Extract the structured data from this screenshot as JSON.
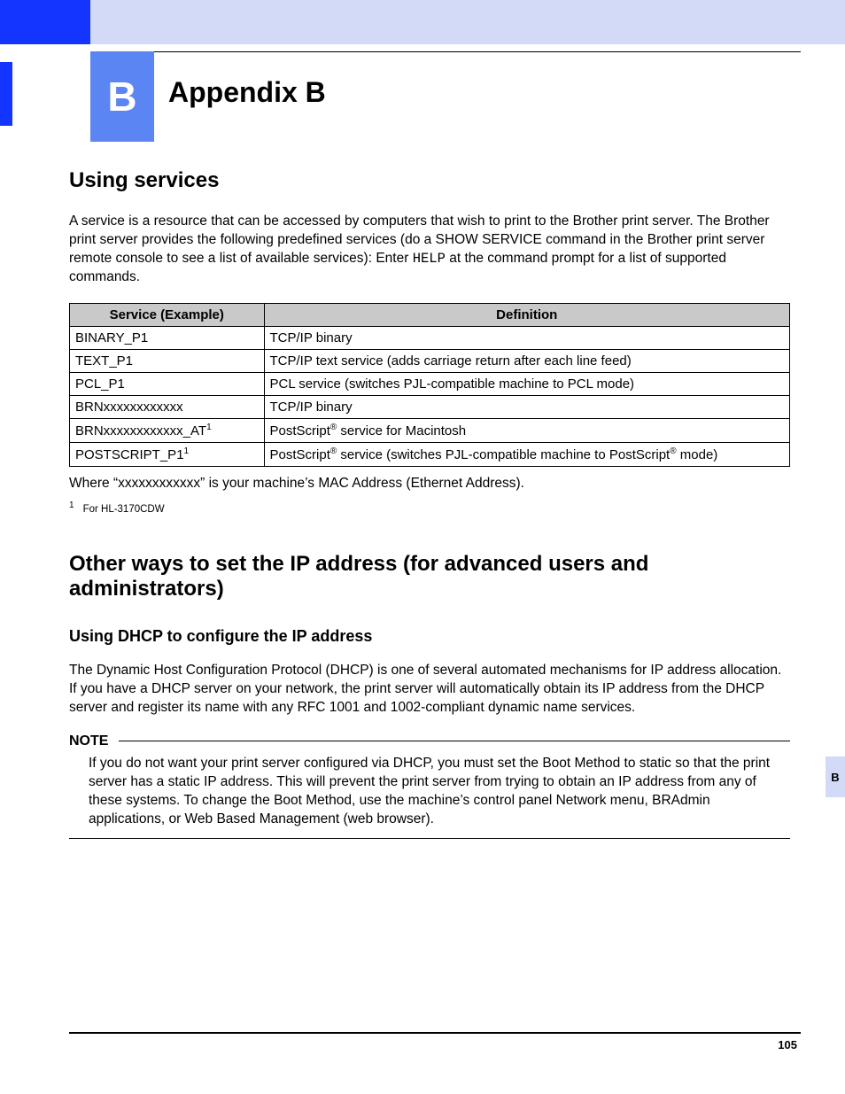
{
  "header": {
    "tab": "B",
    "title": "Appendix B"
  },
  "section1": {
    "heading": "Using services",
    "para_a": "A service is a resource that can be accessed by computers that wish to print to the Brother print server. The Brother print server provides the following predefined services (do a SHOW SERVICE command in the Brother print server remote console to see a list of available services): Enter ",
    "code": "HELP",
    "para_b": " at the command prompt for a list of supported commands."
  },
  "table": {
    "headers": {
      "c1": "Service (Example)",
      "c2": "Definition"
    },
    "rows": [
      {
        "svc": "BINARY_P1",
        "def_a": "TCP/IP binary"
      },
      {
        "svc": "TEXT_P1",
        "def_a": "TCP/IP text service (adds carriage return after each line feed)"
      },
      {
        "svc": "PCL_P1",
        "def_a": "PCL service (switches PJL-compatible machine to PCL mode)"
      },
      {
        "svc": "BRNxxxxxxxxxxxx",
        "def_a": "TCP/IP binary"
      },
      {
        "svc": "BRNxxxxxxxxxxxx_AT",
        "svc_sup": "1",
        "def_a": "PostScript",
        "def_sup1": "®",
        "def_b": " service for Macintosh"
      },
      {
        "svc": "POSTSCRIPT_P1",
        "svc_sup": "1",
        "def_a": "PostScript",
        "def_sup1": "®",
        "def_b": " service (switches PJL-compatible machine to PostScript",
        "def_sup2": "®",
        "def_c": " mode)"
      }
    ],
    "where": "Where “xxxxxxxxxxxx” is your machine’s MAC Address (Ethernet Address).",
    "footnote_num": "1",
    "footnote": "For HL-3170CDW"
  },
  "section2": {
    "heading": "Other ways to set the IP address (for advanced users and administrators)",
    "sub": "Using DHCP to configure the IP address",
    "para": "The Dynamic Host Configuration Protocol (DHCP) is one of several automated mechanisms for IP address allocation. If you have a DHCP server on your network, the print server will automatically obtain its IP address from the DHCP server and register its name with any RFC 1001 and 1002-compliant dynamic name services.",
    "note_label": "NOTE",
    "note_body": "If you do not want your print server configured via DHCP, you must set the Boot Method to static so that the print server has a static IP address. This will prevent the print server from trying to obtain an IP address from any of these systems. To change the Boot Method, use the machine’s control panel Network menu, BRAdmin applications, or Web Based Management (web browser)."
  },
  "side_tab": "B",
  "page_number": "105"
}
